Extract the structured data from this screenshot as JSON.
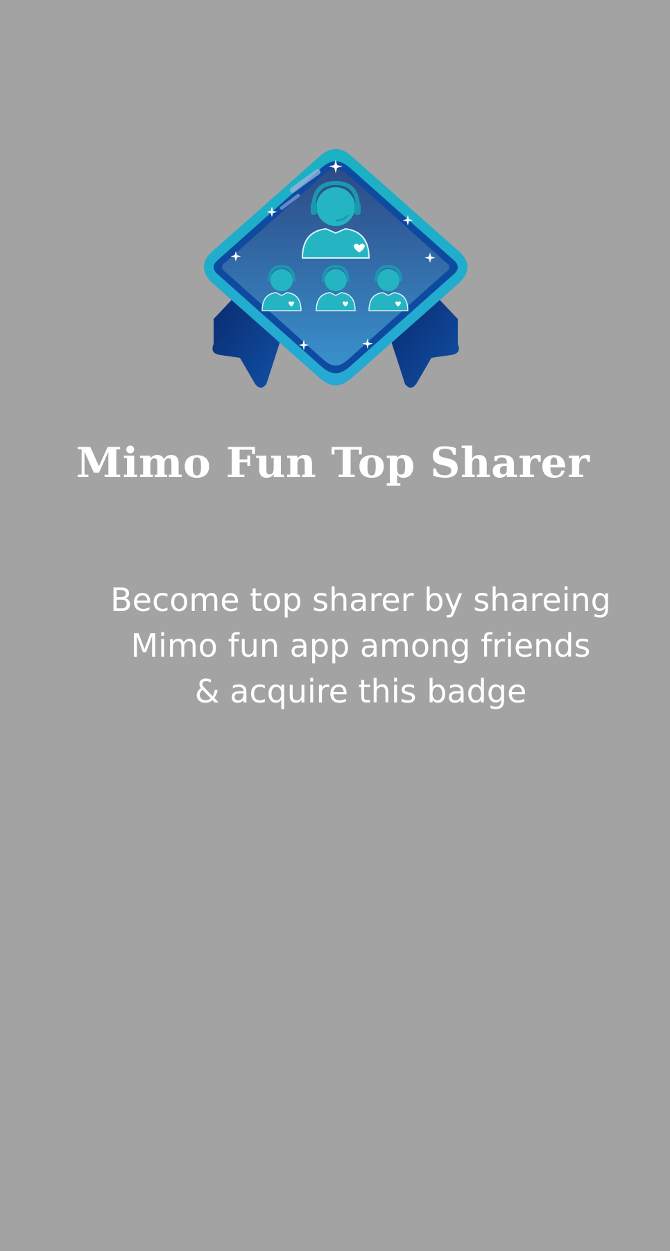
{
  "badge": {
    "icon": "top-sharer-badge-icon",
    "title": "Mimo Fun Top Sharer",
    "description_lines": [
      "Become top sharer by shareing",
      "Mimo fun app among friends",
      "& acquire this badge"
    ]
  },
  "colors": {
    "background": "#a3a3a3",
    "text": "#ffffff",
    "badge_rim": "#1fb4c4",
    "badge_inner_top": "#2f4f8c",
    "badge_inner_bottom": "#3a8cc8",
    "ribbon": "#0c3a86",
    "figure": "#25b5c2"
  }
}
